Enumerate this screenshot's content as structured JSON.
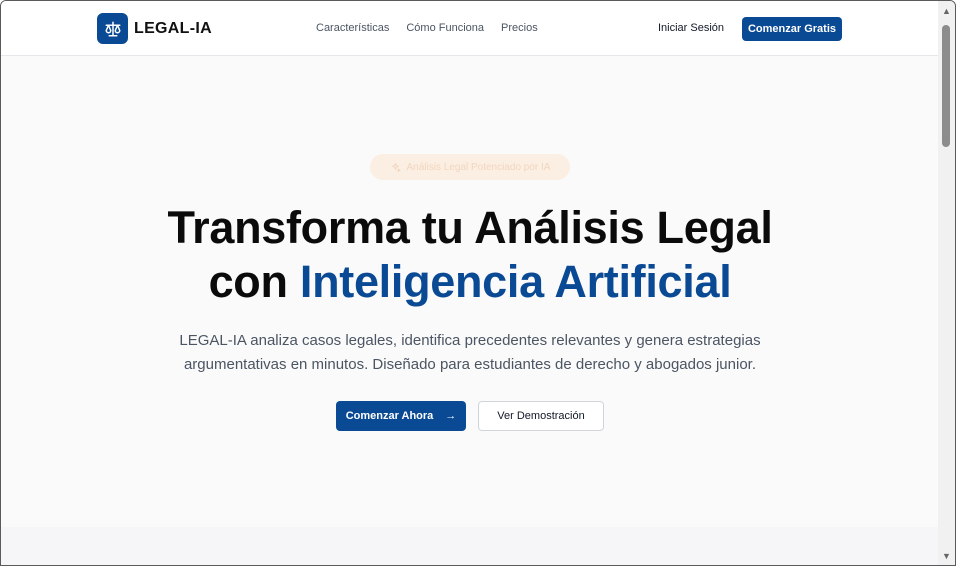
{
  "navbar": {
    "brand": "LEGAL-IA",
    "links": [
      "Características",
      "Cómo Funciona",
      "Precios"
    ],
    "login_label": "Iniciar Sesión",
    "cta_label": "Comenzar Gratis"
  },
  "hero": {
    "badge": "Análisis Legal Potenciado por IA",
    "title_line1": "Transforma tu Análisis Legal",
    "title_line2_prefix": "con",
    "title_line2_accent": "Inteligencia Artificial",
    "description_line1": "LEGAL-IA analiza casos legales, identifica precedentes relevantes y genera estrategias",
    "description_line2": "argumentativas en minutos. Diseñado para estudiantes de derecho y abogados junior.",
    "primary_button": "Comenzar Ahora",
    "primary_button_icon": "→",
    "secondary_button": "Ver Demostración"
  },
  "colors": {
    "brand": "#0a4a94",
    "background": "#fafafa",
    "badge_bg": "#fbeee2"
  },
  "icons": {
    "logo": "scale-icon",
    "badge": "sparkles-icon",
    "arrow": "arrow-right-icon"
  }
}
